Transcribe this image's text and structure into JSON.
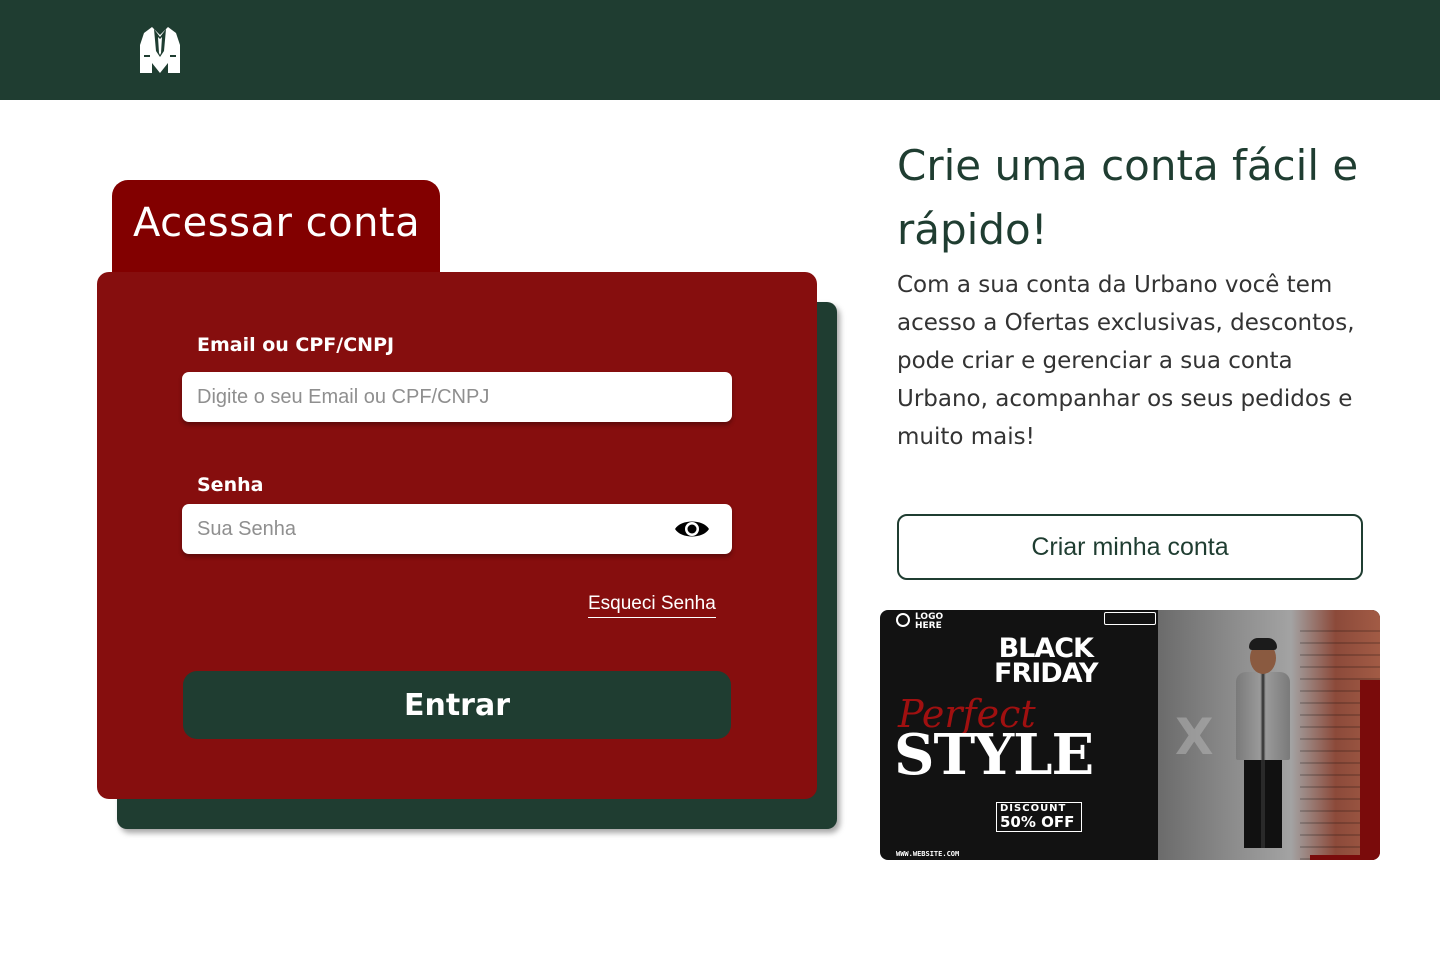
{
  "header": {
    "logo_icon": "suit-jacket-icon",
    "background": "#1f3d31"
  },
  "login": {
    "tab_title": "Acessar conta",
    "email_label": "Email ou CPF/CNPJ",
    "email_placeholder": "Digite o seu Email ou CPF/CNPJ",
    "email_value": "",
    "password_label": "Senha",
    "password_placeholder": "Sua Senha",
    "password_value": "",
    "password_toggle_icon": "eye-icon",
    "forgot_link": "Esqueci Senha",
    "submit_label": "Entrar",
    "card_color": "#860e0e",
    "tab_color": "#820000",
    "shadow_card_color": "#1f3d31"
  },
  "promo": {
    "title": "Crie uma conta fácil e rápido!",
    "text": "Com a sua conta da Urbano você tem acesso a Ofertas exclusivas, descontos, pode criar e gerenciar a sua conta Urbano, acompanhar os seus pedidos e muito mais!",
    "create_button": "Criar minha conta",
    "accent": "#1f3d31"
  },
  "banner": {
    "logo_text": "LOGO HERE",
    "headline": "BLACK\nFRIDAY",
    "script_text": "Perfect",
    "big_text": "STYLE",
    "discount_label": "DISCOUNT",
    "discount_value": "50% OFF",
    "website": "WWW.WEBSITE.COM"
  }
}
